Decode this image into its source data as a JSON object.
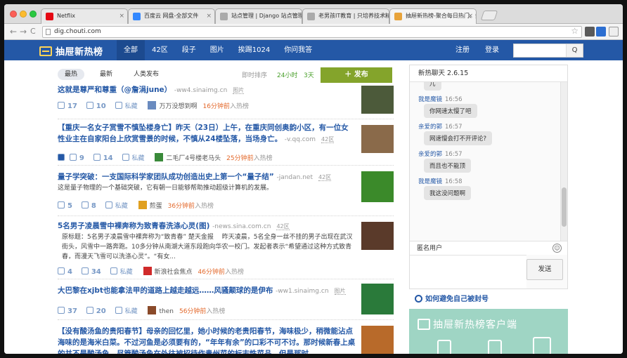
{
  "browser": {
    "tabs": [
      {
        "title": "Netflix",
        "favicon_color": "#e50914"
      },
      {
        "title": "百度云 网盘-全部文件",
        "favicon_color": "#3388ff"
      },
      {
        "title": "站点管理 | Django 站点管理",
        "favicon_color": "#aaaaaa"
      },
      {
        "title": "老男孩IT教育 | 只培养技术精英",
        "favicon_color": "#aaaaaa"
      },
      {
        "title": "抽屉新热榜-聚合每日热门、搞笑",
        "favicon_color": "#e8a33a"
      }
    ],
    "close_glyph": "×",
    "back_glyph": "←",
    "forward_glyph": "→",
    "reload_glyph": "C",
    "address": "dig.chouti.com",
    "star_glyph": "☆"
  },
  "site": {
    "logo_text": "抽屉新热榜",
    "nav": [
      "全部",
      "42区",
      "段子",
      "图片",
      "挨踢1024",
      "你问我答"
    ],
    "register": "注册",
    "login": "登录",
    "search_glyph": "Q"
  },
  "subnav": {
    "sorts": [
      "最热",
      "最新",
      "人类发布"
    ],
    "timeframe_label": "即时排序",
    "timeframes": [
      "24小时",
      "3天"
    ],
    "publish": "＋  发布"
  },
  "items": [
    {
      "title": "这就是尊严和尊重（@詹涓june）",
      "domain": "-ww4.sinaimg.cn",
      "tag": "图片",
      "desc": "",
      "up": "17",
      "comments": "10",
      "save": "私藏",
      "user": "万万没想到啊",
      "time": "16分钟前",
      "into": "入热榜",
      "thumb_color": "#4c5a3a",
      "avatar_color": "#6a8bbf",
      "play": false
    },
    {
      "title": "【重庆一名女子赏雪不慎坠楼身亡】昨天（23日）上午，在重庆同创奥韵小区，有一位女性业主在自家阳台上欣赏雪景的时候，不慎从24楼坠落，当场身亡。",
      "domain": "-v.qq.com",
      "tag": "42区",
      "desc": "",
      "up": "9",
      "comments": "14",
      "save": "私藏",
      "user": "二毛厂4号楼老马头",
      "time": "25分钟前",
      "into": "入热榜",
      "thumb_color": "#8a6a4a",
      "avatar_color": "#3a8a3a",
      "play": true
    },
    {
      "title": "量子学突破：一支国际科学家团队成功创造出史上第一个“量子结”",
      "domain": "-jandan.net",
      "tag": "42区",
      "desc": "这是量子物理的一个基础突破，它有朝一日能够帮助推动超级计算机的发展。",
      "up": "5",
      "comments": "8",
      "save": "私藏",
      "user": "煎蛋",
      "time": "36分钟前",
      "into": "入热榜",
      "thumb_color": "#3b8a2a",
      "avatar_color": "#e0a020",
      "play": false
    },
    {
      "title": "5名男子凌晨雪中裸奔称为致青春洗涤心灵(图)",
      "domain": "-news.sina.com.cn",
      "tag": "42区",
      "desc": "原标题：5名男子凌晨雪中裸奔称为“致青春” 楚天金报 　昨天凌晨，5名全身一丝不挂的男子出现在武汉街头，风雪中一路奔跑。10多分钟从南湖大道东段跑向华农一校门。发起者表示“希望通过这种方式致青春，而漫天飞雪可以洗涤心灵”。“有女...",
      "up": "4",
      "comments": "34",
      "save": "私藏",
      "user": "新浪社会焦点",
      "time": "46分钟前",
      "into": "入热榜",
      "thumb_color": "#5a3a2a",
      "avatar_color": "#d02a2a",
      "play": false
    },
    {
      "title": "大巴黎在xjbt也能拿法甲的道路上越走越远……风骚颠球的是伊布",
      "domain": "-ww1.sinaimg.cn",
      "tag": "图片",
      "desc": "",
      "up": "37",
      "comments": "20",
      "save": "私藏",
      "user": "then",
      "time": "56分钟前",
      "into": "入热榜",
      "thumb_color": "#2a7a3a",
      "avatar_color": "#8a4a2a",
      "play": false
    },
    {
      "title": "【没有酸汤鱼的贵阳春节】母亲的回忆里，她小时候的老贵阳春节，海味极少，稍微能沾点海味的是海米白菜。不过河鱼是必须要有的，“年年有余”的口彩不可不讨。那时候新春上桌的并不是酸汤鱼，尽管酸汤鱼在外往被招待作贵州菜的标志性菜品，但是那时",
      "domain": "",
      "tag": "",
      "desc": "",
      "up": "",
      "comments": "",
      "save": "",
      "user": "",
      "time": "",
      "into": "",
      "thumb_color": "#b86a2a",
      "avatar_color": "#888888",
      "play": false
    }
  ],
  "chat": {
    "title": "新热聊天 2.6.15",
    "messages": [
      {
        "from": "",
        "time": "",
        "text": "儿"
      },
      {
        "from": "我是魔镜",
        "time": "16:56",
        "text": "你网速太慢了吧"
      },
      {
        "from": "亲爱的郭",
        "time": "16:57",
        "text": "网速慢会打不开评论?"
      },
      {
        "from": "亲爱的郭",
        "time": "16:57",
        "text": "而且也不能顶"
      },
      {
        "from": "我是魔镜",
        "time": "16:58",
        "text": "我这没问题啊"
      }
    ],
    "anonymous": "匿名用户",
    "emoji": "☺",
    "send": "发送"
  },
  "avoid_link": "如何避免自己被封号",
  "promo_text": "抽屉新热榜客户端"
}
